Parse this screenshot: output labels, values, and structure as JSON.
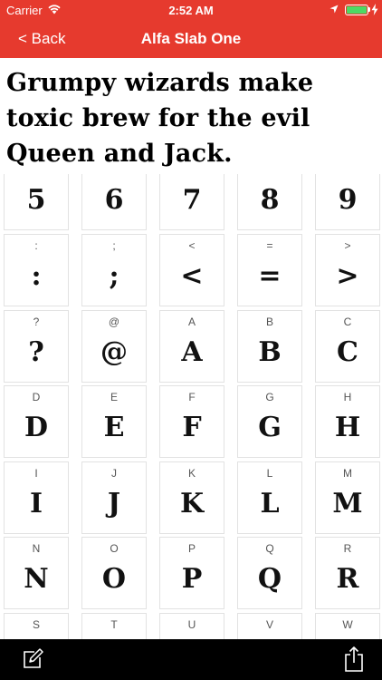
{
  "status_bar": {
    "carrier": "Carrier",
    "time": "2:52 AM"
  },
  "nav": {
    "back_label": "< Back",
    "title": "Alfa Slab One"
  },
  "sample_text": "Grumpy wizards make toxic brew for the evil Queen and Jack.",
  "glyph_rows": [
    {
      "cells": [
        {
          "label": "",
          "glyph": "5"
        },
        {
          "label": "",
          "glyph": "6"
        },
        {
          "label": "",
          "glyph": "7"
        },
        {
          "label": "",
          "glyph": "8"
        },
        {
          "label": "",
          "glyph": "9"
        }
      ]
    },
    {
      "cells": [
        {
          "label": ":",
          "glyph": ":"
        },
        {
          "label": ";",
          "glyph": ";"
        },
        {
          "label": "<",
          "glyph": "<"
        },
        {
          "label": "=",
          "glyph": "="
        },
        {
          "label": ">",
          "glyph": ">"
        }
      ]
    },
    {
      "cells": [
        {
          "label": "?",
          "glyph": "?"
        },
        {
          "label": "@",
          "glyph": "@"
        },
        {
          "label": "A",
          "glyph": "A"
        },
        {
          "label": "B",
          "glyph": "B"
        },
        {
          "label": "C",
          "glyph": "C"
        }
      ]
    },
    {
      "cells": [
        {
          "label": "D",
          "glyph": "D"
        },
        {
          "label": "E",
          "glyph": "E"
        },
        {
          "label": "F",
          "glyph": "F"
        },
        {
          "label": "G",
          "glyph": "G"
        },
        {
          "label": "H",
          "glyph": "H"
        }
      ]
    },
    {
      "cells": [
        {
          "label": "I",
          "glyph": "I"
        },
        {
          "label": "J",
          "glyph": "J"
        },
        {
          "label": "K",
          "glyph": "K"
        },
        {
          "label": "L",
          "glyph": "L"
        },
        {
          "label": "M",
          "glyph": "M"
        }
      ]
    },
    {
      "cells": [
        {
          "label": "N",
          "glyph": "N"
        },
        {
          "label": "O",
          "glyph": "O"
        },
        {
          "label": "P",
          "glyph": "P"
        },
        {
          "label": "Q",
          "glyph": "Q"
        },
        {
          "label": "R",
          "glyph": "R"
        }
      ]
    },
    {
      "cells": [
        {
          "label": "S",
          "glyph": ""
        },
        {
          "label": "T",
          "glyph": ""
        },
        {
          "label": "U",
          "glyph": ""
        },
        {
          "label": "V",
          "glyph": ""
        },
        {
          "label": "W",
          "glyph": ""
        }
      ]
    }
  ],
  "colors": {
    "header": "#e63a2e",
    "battery": "#4cd964",
    "toolbar": "#000000"
  },
  "icons": {
    "wifi": "wifi-icon",
    "location": "location-arrow-icon",
    "battery": "battery-icon",
    "charging": "charging-bolt-icon",
    "edit": "edit-icon",
    "share": "share-icon"
  }
}
